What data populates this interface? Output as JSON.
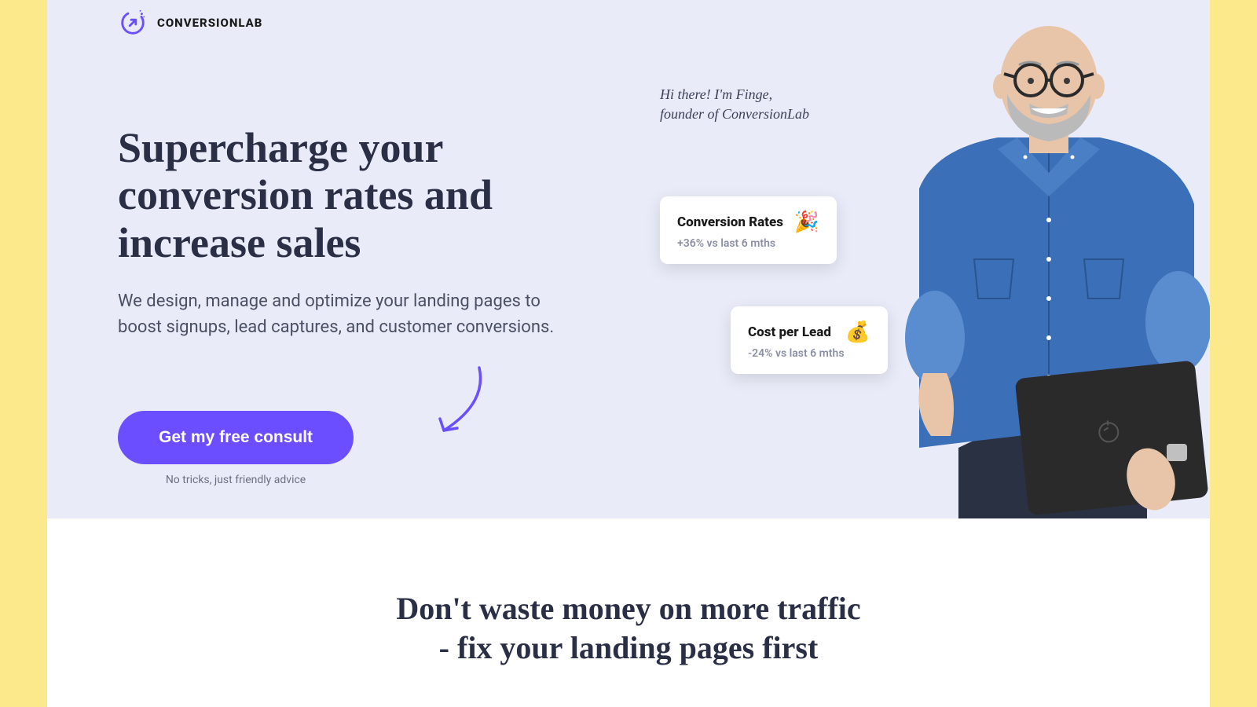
{
  "brand": {
    "name": "CONVERSIONLAB"
  },
  "hero": {
    "headline": "Supercharge your conversion rates and increase sales",
    "subhead": "We design, manage and optimize your landing pages to boost signups, lead captures, and customer conversions.",
    "cta_label": "Get my free consult",
    "cta_note": "No tricks, just friendly advice",
    "speech_line1": "Hi there! I'm Finge,",
    "speech_line2": "founder of ConversionLab"
  },
  "cards": [
    {
      "title": "Conversion Rates",
      "sub": "+36% vs last 6 mths",
      "emoji": "🎉"
    },
    {
      "title": "Cost per Lead",
      "sub": "-24% vs last 6 mths",
      "emoji": "💰"
    }
  ],
  "section2": {
    "line1": "Don't waste money on more traffic",
    "line2": "- fix your landing pages first"
  }
}
